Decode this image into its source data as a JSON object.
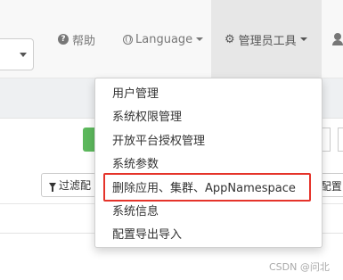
{
  "navbar": {
    "help_label": "帮助",
    "language_label": "Language",
    "admin_tools_label": "管理员工具"
  },
  "toolbar": {
    "filter_label": "过滤配",
    "config_label": "t配置"
  },
  "admin_menu": {
    "items": [
      {
        "label": "用户管理"
      },
      {
        "label": "系统权限管理"
      },
      {
        "label": "开放平台授权管理"
      },
      {
        "label": "系统参数"
      },
      {
        "label": "删除应用、集群、AppNamespace",
        "highlighted": true
      },
      {
        "label": "系统信息"
      },
      {
        "label": "配置导出导入"
      }
    ]
  },
  "watermark": "CSDN @问北",
  "colors": {
    "highlight_border": "#e5332a",
    "success": "#5cb85c",
    "navbar_bg": "#f8f8f8",
    "active_nav_bg": "#e7e7e7"
  }
}
